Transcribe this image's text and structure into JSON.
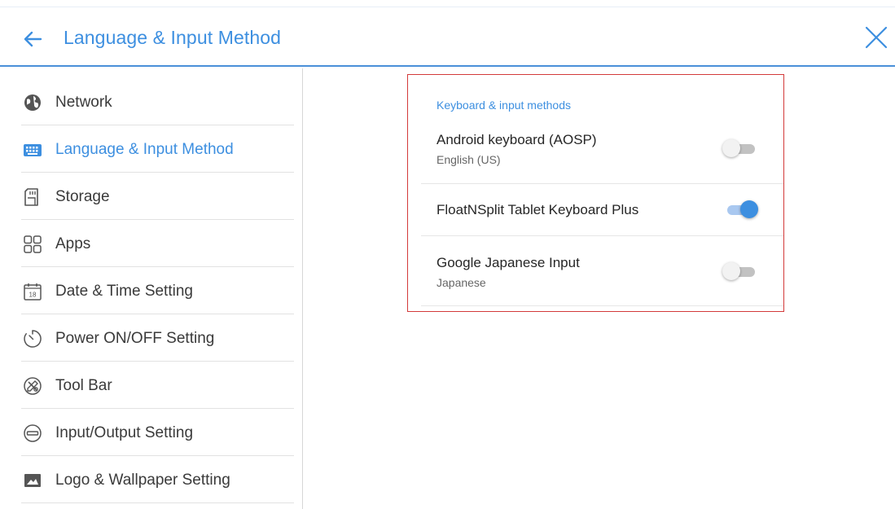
{
  "header": {
    "title": "Language & Input Method"
  },
  "sidebar": {
    "items": [
      {
        "label": "Network",
        "icon": "globe-icon"
      },
      {
        "label": "Language & Input Method",
        "icon": "keyboard-icon",
        "active": true
      },
      {
        "label": "Storage",
        "icon": "sd-card-icon"
      },
      {
        "label": "Apps",
        "icon": "apps-grid-icon"
      },
      {
        "label": "Date & Time Setting",
        "icon": "calendar-icon",
        "icon_text": "18"
      },
      {
        "label": "Power ON/OFF Setting",
        "icon": "timer-icon"
      },
      {
        "label": "Tool Bar",
        "icon": "toolbar-icon"
      },
      {
        "label": "Input/Output Setting",
        "icon": "input-output-icon"
      },
      {
        "label": "Logo & Wallpaper Setting",
        "icon": "image-icon"
      }
    ]
  },
  "panel": {
    "section_label": "Keyboard & input methods",
    "rows": [
      {
        "name": "Android keyboard (AOSP)",
        "sub": "English (US)",
        "enabled": false
      },
      {
        "name": "FloatNSplit Tablet Keyboard Plus",
        "sub": "",
        "enabled": true
      },
      {
        "name": "Google Japanese Input",
        "sub": "Japanese",
        "enabled": false
      }
    ]
  },
  "colors": {
    "accent": "#3d8fe0",
    "highlight_border": "#d33a3a",
    "toggle_off_track": "#c2c2c2",
    "toggle_on_track": "#a9c8f0"
  }
}
